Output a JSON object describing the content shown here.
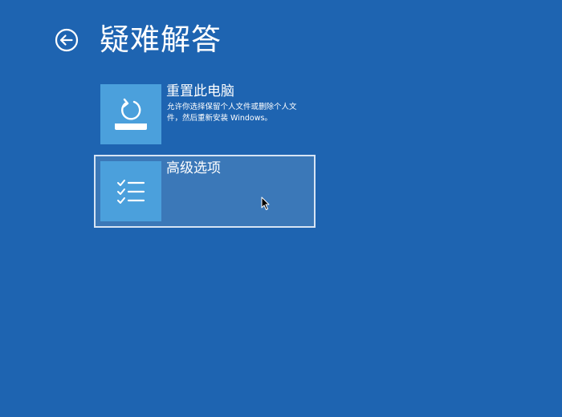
{
  "page": {
    "title": "疑难解答",
    "back_icon": "back-arrow-circle-icon"
  },
  "options": [
    {
      "title": "重置此电脑",
      "description": "允许你选择保留个人文件或删除个人文件，然后重新安装 Windows。",
      "icon": "reset-pc-icon"
    },
    {
      "title": "高级选项",
      "description": "",
      "icon": "checklist-icon",
      "state": "hovered"
    }
  ],
  "colors": {
    "background": "#1e64b1",
    "icon_tile": "#4ba0dc",
    "hover_fill": "#3b78b8",
    "hover_border": "#d6e4f4",
    "text": "#ffffff"
  }
}
